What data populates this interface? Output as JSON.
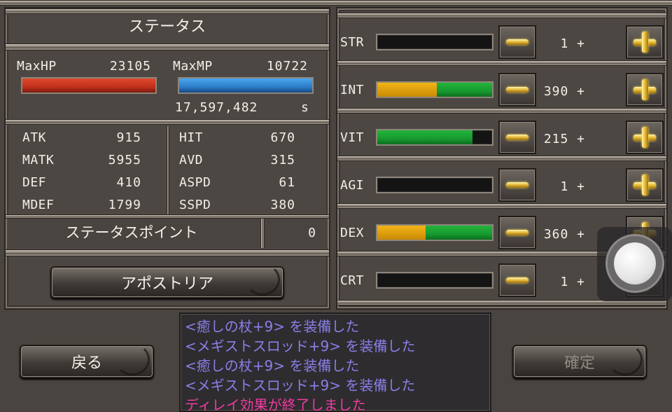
{
  "status_title": "ステータス",
  "hp": {
    "label": "MaxHP",
    "value": "23105",
    "fill": 1.0,
    "color": "#c0301c"
  },
  "mp": {
    "label": "MaxMP",
    "value": "10722",
    "fill": 1.0,
    "color": "#2c7cc8"
  },
  "timer": {
    "value": "17,597,482",
    "unit": "s"
  },
  "stats": [
    {
      "label": "ATK",
      "value": "915"
    },
    {
      "label": "HIT",
      "value": "670"
    },
    {
      "label": "MATK",
      "value": "5955"
    },
    {
      "label": "AVD",
      "value": "315"
    },
    {
      "label": "DEF",
      "value": "410"
    },
    {
      "label": "ASPD",
      "value": "61"
    },
    {
      "label": "MDEF",
      "value": "1799"
    },
    {
      "label": "SSPD",
      "value": "380"
    }
  ],
  "points": {
    "label": "ステータスポイント",
    "value": "0"
  },
  "apostoria_button": "アポストリア",
  "back_button": "戻る",
  "confirm_button": "確定",
  "attributes": [
    {
      "label": "STR",
      "value": "1 +",
      "yellow_fill": 0.0,
      "green_fill": 0.0
    },
    {
      "label": "INT",
      "value": "390 +",
      "yellow_fill": 0.52,
      "green_fill": 0.48
    },
    {
      "label": "VIT",
      "value": "215 +",
      "yellow_fill": 0.0,
      "green_fill": 0.83
    },
    {
      "label": "AGI",
      "value": "1 +",
      "yellow_fill": 0.0,
      "green_fill": 0.0
    },
    {
      "label": "DEX",
      "value": "360 +",
      "yellow_fill": 0.42,
      "green_fill": 0.58
    },
    {
      "label": "CRT",
      "value": "1 +",
      "yellow_fill": 0.0,
      "green_fill": 0.0
    }
  ],
  "log_lines": [
    {
      "text": "<癒しの杖+9> を装備した",
      "color": "#8a7fe8"
    },
    {
      "text": "<メギストスロッド+9> を装備した",
      "color": "#8a7fe8"
    },
    {
      "text": "<癒しの杖+9> を装備した",
      "color": "#8a7fe8"
    },
    {
      "text": "<メギストスロッド+9> を装備した",
      "color": "#8a7fe8"
    },
    {
      "text": "ディレイ効果が終了しました",
      "color": "#f03ca0"
    }
  ],
  "colors": {
    "bar_yellow": "#f2b416",
    "bar_green": "#179a2e",
    "panel": "#4d4743"
  }
}
